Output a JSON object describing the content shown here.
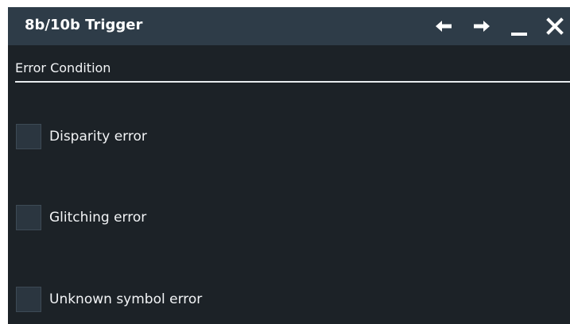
{
  "window": {
    "title": "8b/10b Trigger",
    "controls": {
      "back_icon": "arrow-left-icon",
      "forward_icon": "arrow-right-icon",
      "minimize_icon": "minimize-icon",
      "close_icon": "close-icon"
    }
  },
  "section": {
    "label": "Error Condition"
  },
  "options": [
    {
      "label": "Disparity error",
      "checked": false
    },
    {
      "label": "Glitching error",
      "checked": false
    },
    {
      "label": "Unknown symbol error",
      "checked": false
    }
  ],
  "colors": {
    "titlebar": "#2e3c48",
    "panel": "#1c2227",
    "checkbox": "#2b3640",
    "text": "#f2f4f6"
  }
}
